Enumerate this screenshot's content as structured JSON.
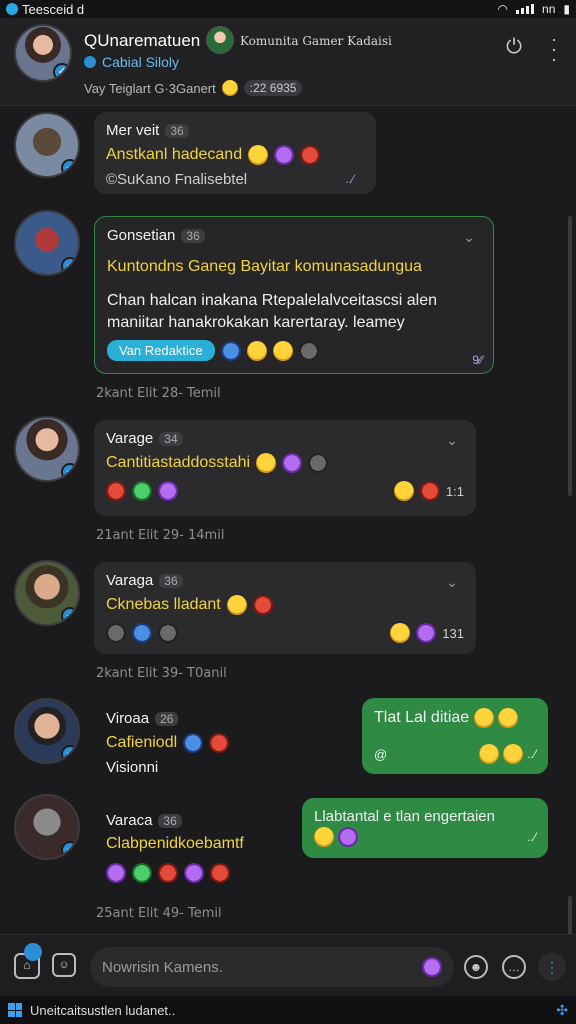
{
  "status_bar": {
    "title": "Teesceid d",
    "right": "nn"
  },
  "header": {
    "title": "QUnarematuen",
    "sub_name": "Komunita Gamer Kadaisi",
    "status": "Cabial Siloly",
    "meta_text": "Vay Teiglart G·3Ganert",
    "meta_pill": ":22 6935"
  },
  "messages": [
    {
      "name": "Mer veit",
      "count": "36",
      "yellow": "Anstkanl hadecand",
      "grey": "©SuKano Fnalisebtel",
      "tick": "..⁄"
    },
    {
      "name": "Gonsetian",
      "count": "36",
      "yellow": "Kuntondns Ganeg Bayitar komunasadungua",
      "white": "Chan halcan inakana Rtepalelalvceitascsi alen maniitar hanakrokakan karertaray. leamey",
      "tag": "Van Redaktice",
      "tick": "9⁄⁄",
      "time": "2kant Elit    28- Temil"
    },
    {
      "name": "Varage",
      "count": "34",
      "yellow": "Cantitiastaddosstahi",
      "count2": "1:1",
      "time": "21ant Elit    29- 14mil"
    },
    {
      "name": "Varaga",
      "count": "36",
      "yellow": "Cknebas lladant",
      "count2": "131",
      "time": "2kant Elit    39- T0anil"
    },
    {
      "name": "Viroaa",
      "count": "26",
      "yellow": "Cafieniodl",
      "grey": "Visionni",
      "reply": "Tlat Lal ditiae"
    },
    {
      "name": "Varaca",
      "count": "36",
      "yellow": "Clabpenidkoebamtf",
      "reply": "Llabtantal e tlan engertaien",
      "time": "25ant Elit    49- Temil"
    }
  ],
  "composer": {
    "placeholder": "Nowrisin Kamens."
  },
  "taskbar": {
    "text": "Uneitcaitsustlen ludanet.."
  }
}
